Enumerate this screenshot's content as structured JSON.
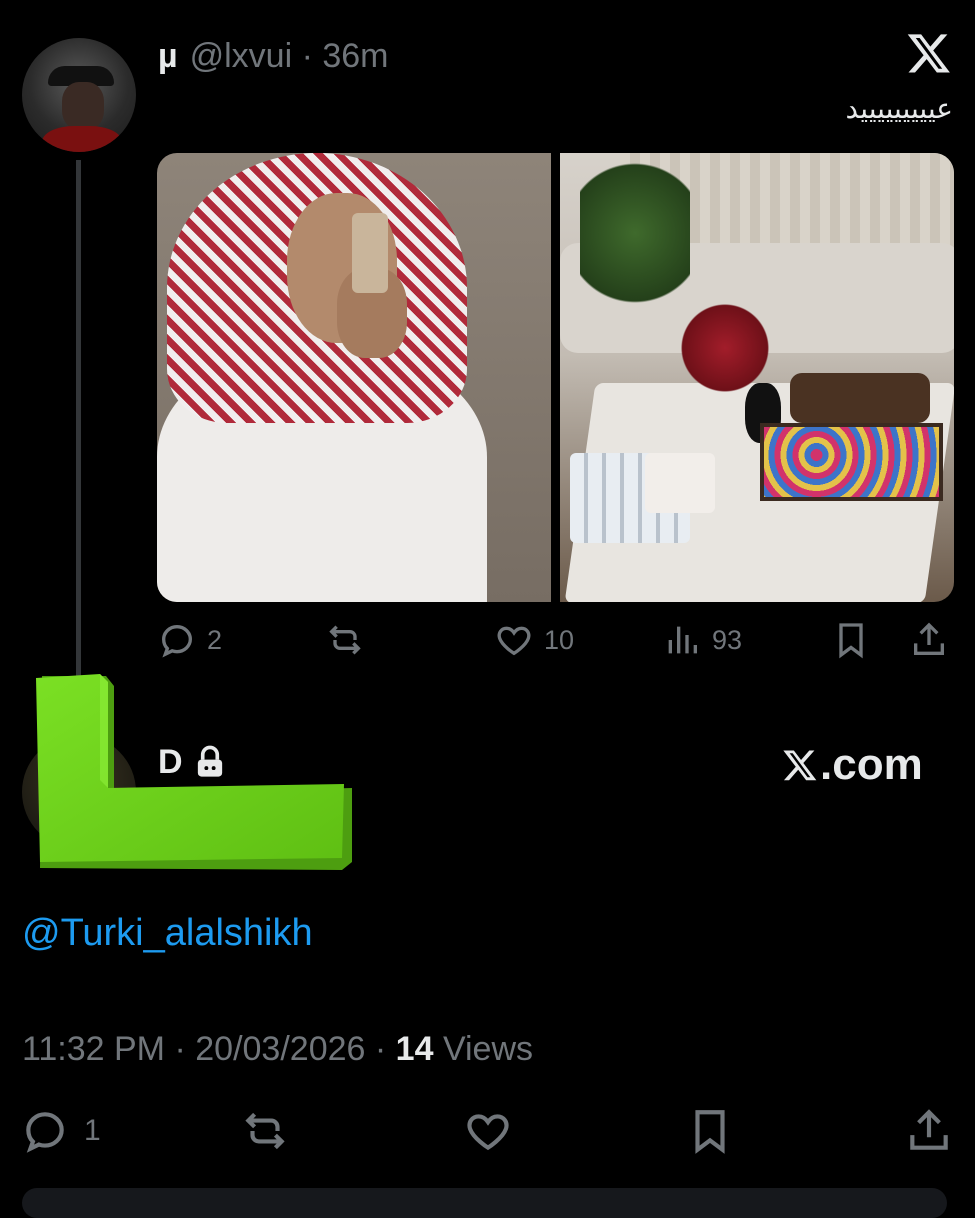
{
  "tweet1": {
    "name": "µ",
    "handle": "@lxvui",
    "separator": "·",
    "time": "36m",
    "text": "عيييييييييد",
    "media": [
      {
        "icon": "selfie-photo"
      },
      {
        "icon": "living-room-eid-photo"
      }
    ],
    "actions": {
      "replies": "2",
      "likes": "10",
      "views": "93"
    }
  },
  "tweet2": {
    "name": "D",
    "brand": ".com",
    "mention": "@Turki_alalshikh",
    "time": "11:32 PM",
    "separator": "·",
    "date": "20/03/2026",
    "views_count": "14",
    "views_label": "Views",
    "actions": {
      "replies": "1"
    }
  },
  "colors": {
    "background": "#000000",
    "text": "#e7e9ea",
    "muted": "#71767b",
    "link": "#1d9bf0",
    "overlay_green": "#6fd21f"
  }
}
